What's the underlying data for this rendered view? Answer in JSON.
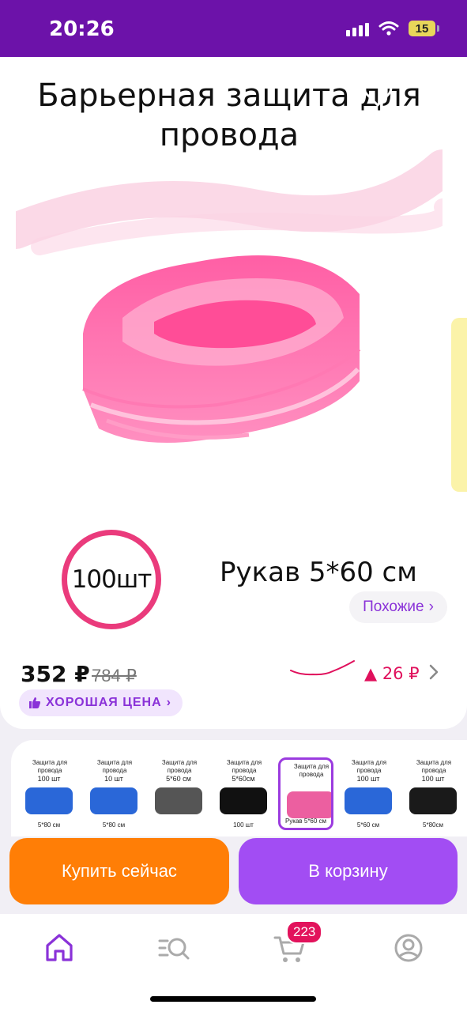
{
  "status": {
    "time": "20:26",
    "battery": "15"
  },
  "image": {
    "title_line1": "Барьерная защита для",
    "title_line2": "провода",
    "count_label": "100шт",
    "size_label": "Рукав 5*60 см"
  },
  "similar": {
    "label": "Похожие",
    "chevron": "›"
  },
  "price": {
    "current": "352 ₽",
    "old": "784 ₽",
    "delta": "▲ 26 ₽"
  },
  "badge": {
    "label": "ХОРОШАЯ ЦЕНА",
    "chevron": "›"
  },
  "thumbnails": [
    {
      "title": "Защита для провода",
      "qty": "100 шт",
      "size": "5*80 см",
      "color": "#2a67d8"
    },
    {
      "title": "Защита для провода",
      "qty": "10 шт",
      "size": "5*80 см",
      "color": "#2a67d8"
    },
    {
      "title": "Защита для провода",
      "qty": "5*60 см",
      "size": "",
      "color": "#555555"
    },
    {
      "title": "Защита для провода",
      "qty": "5*60см",
      "size": "100 шт",
      "color": "#111111"
    },
    {
      "title": "Защита для провода",
      "qty": "",
      "size": "Рукав 5*60 см",
      "color": "#ec5fa0"
    },
    {
      "title": "Защита для провода",
      "qty": "100 шт",
      "size": "5*60 см",
      "color": "#2a67d8"
    },
    {
      "title": "Защита для провода",
      "qty": "100 шт",
      "size": "5*80см",
      "color": "#1a1a1a"
    }
  ],
  "actions": {
    "buy_now": "Купить сейчас",
    "to_cart": "В корзину"
  },
  "tabbar": {
    "cart_count": "223"
  },
  "colors": {
    "brand": "#6c12a9",
    "accent": "#a24df3",
    "buy": "#ff7e06",
    "pink": "#ea3b7c"
  }
}
